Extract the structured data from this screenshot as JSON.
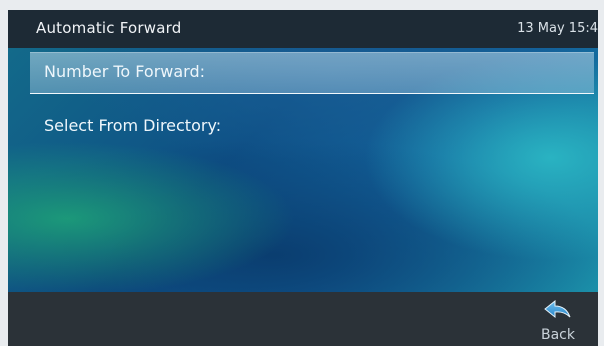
{
  "header": {
    "title": "Automatic Forward",
    "datetime": "13 May 15:4"
  },
  "menu": {
    "items": [
      {
        "label": "Number To Forward:",
        "selected": true
      },
      {
        "label": "Select From Directory:",
        "selected": false
      }
    ]
  },
  "softkeys": {
    "back": {
      "label": "Back",
      "icon": "back-arrow-icon"
    }
  },
  "colors": {
    "header_bg": "#1d2a35",
    "softkey_bg": "#2b3238",
    "accent": "#3aa0e0",
    "text": "#eef6fb"
  }
}
